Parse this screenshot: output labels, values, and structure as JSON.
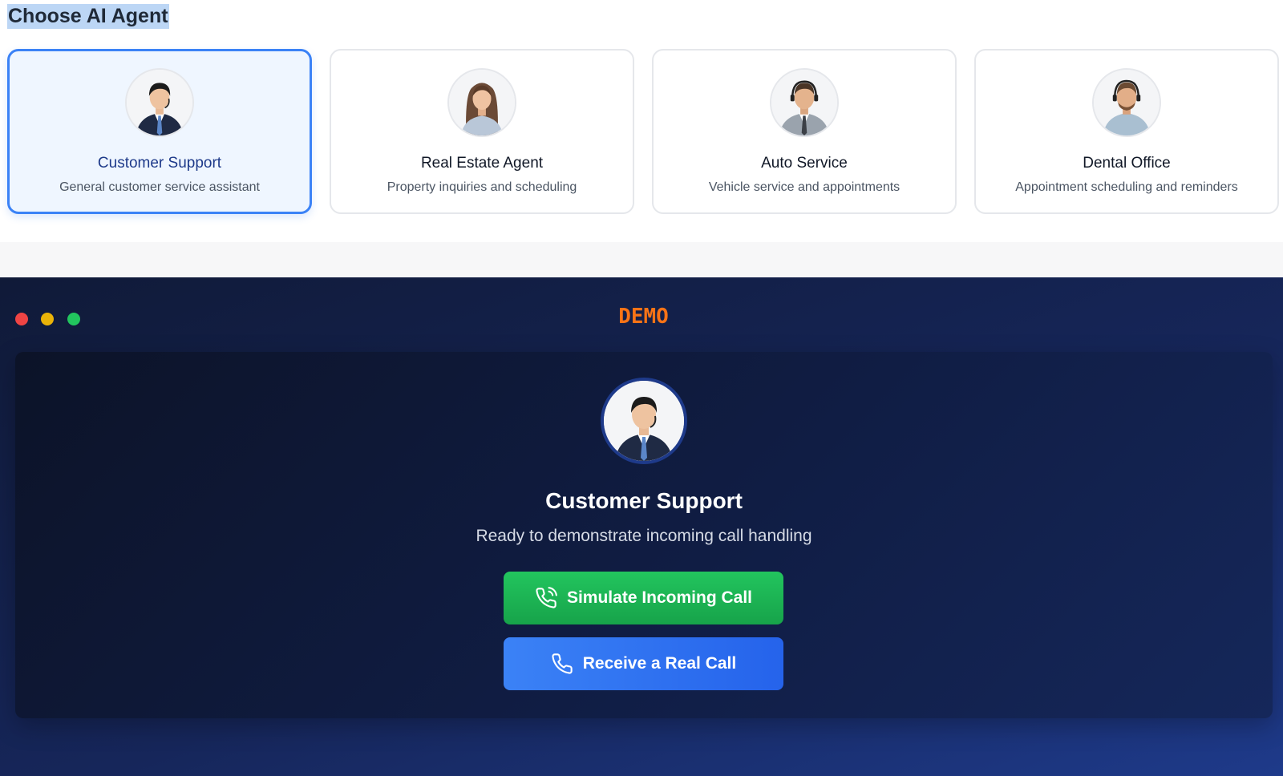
{
  "selector": {
    "title": "Choose AI Agent",
    "selected_index": 0,
    "agents": [
      {
        "title": "Customer Support",
        "description": "General customer service assistant",
        "avatar": "agent-avatar-support"
      },
      {
        "title": "Real Estate Agent",
        "description": "Property inquiries and scheduling",
        "avatar": "agent-avatar-real-estate"
      },
      {
        "title": "Auto Service",
        "description": "Vehicle service and appointments",
        "avatar": "agent-avatar-auto"
      },
      {
        "title": "Dental Office",
        "description": "Appointment scheduling and reminders",
        "avatar": "agent-avatar-dental"
      }
    ]
  },
  "demo": {
    "label": "DEMO",
    "window_controls": [
      "close-dot",
      "minimize-dot",
      "maximize-dot"
    ],
    "agent_name": "Customer Support",
    "status": "Ready to demonstrate incoming call handling",
    "simulate_button": {
      "label": "Simulate Incoming Call",
      "icon": "phone-incoming-icon"
    },
    "real_call_button": {
      "label": "Receive a Real Call",
      "icon": "phone-icon"
    }
  },
  "colors": {
    "accent_blue": "#3b82f6",
    "selected_card_bg": "#eff6ff",
    "demo_label": "#f97316",
    "simulate_green": "#22c55e",
    "real_call_blue": "#2563eb",
    "dot_red": "#ef4444",
    "dot_yellow": "#eab308",
    "dot_green": "#22c55e"
  }
}
